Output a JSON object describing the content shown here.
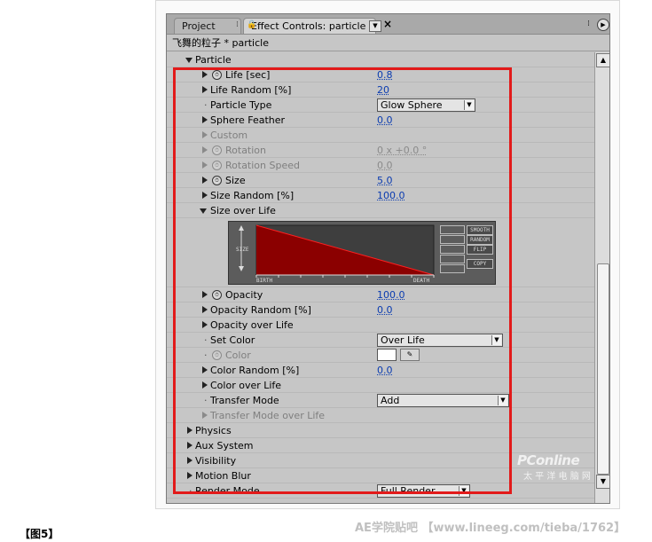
{
  "tabs": {
    "project_label": "Project",
    "effect_controls_label": "Effect Controls: particle"
  },
  "breadcrumb": "飞舞的粒子 * particle",
  "section_header": "Particle",
  "properties": [
    {
      "label": "Life [sec]",
      "value": "0.8",
      "stopwatch": true
    },
    {
      "label": "Life Random [%]",
      "value": "20"
    },
    {
      "label": "Particle Type",
      "select": "Glow Sphere"
    },
    {
      "label": "Sphere Feather",
      "value": "0.0"
    },
    {
      "label": "Custom"
    },
    {
      "label": "Rotation",
      "value": "0 x +0.0 °",
      "stopwatch": true
    },
    {
      "label": "Rotation Speed",
      "value": "0.0",
      "stopwatch": true
    },
    {
      "label": "Size",
      "value": "5.0",
      "stopwatch": true
    },
    {
      "label": "Size Random [%]",
      "value": "100.0"
    },
    {
      "label": "Size over Life"
    }
  ],
  "graph": {
    "y_label": "SIZE",
    "x_start": "BIRTH",
    "x_end": "DEATH",
    "buttons": [
      "SMOOTH",
      "RANDOM",
      "FLIP"
    ],
    "copy_button": "COPY",
    "curve": {
      "start_level": 1.0,
      "end_level": 0.0
    },
    "fill_color": "#8b0000",
    "line_color": "#ff2020"
  },
  "properties2": [
    {
      "label": "Opacity",
      "value": "100.0",
      "stopwatch": true
    },
    {
      "label": "Opacity Random [%]",
      "value": "0.0"
    },
    {
      "label": "Opacity over Life"
    },
    {
      "label": "Set Color",
      "select": "Over Life"
    },
    {
      "label": "Color",
      "stopwatch": true
    },
    {
      "label": "Color Random [%]",
      "value": "0.0"
    },
    {
      "label": "Color over Life"
    },
    {
      "label": "Transfer Mode",
      "select": "Add"
    },
    {
      "label": "Transfer Mode over Life"
    }
  ],
  "groups": [
    "Physics",
    "Aux System",
    "Visibility",
    "Motion Blur"
  ],
  "render_mode": {
    "label": "Render Mode",
    "select": "Full Render"
  },
  "watermark": {
    "brand": "PConline",
    "tagline": "太 平 洋 电 脑 网"
  },
  "caption": "【图5】",
  "footer_watermark": "AE学院贴吧 【www.lineeg.com/tieba/1762】",
  "colors": {
    "highlight_box": "#e21a1a",
    "value_blue": "#0a3bb0"
  }
}
